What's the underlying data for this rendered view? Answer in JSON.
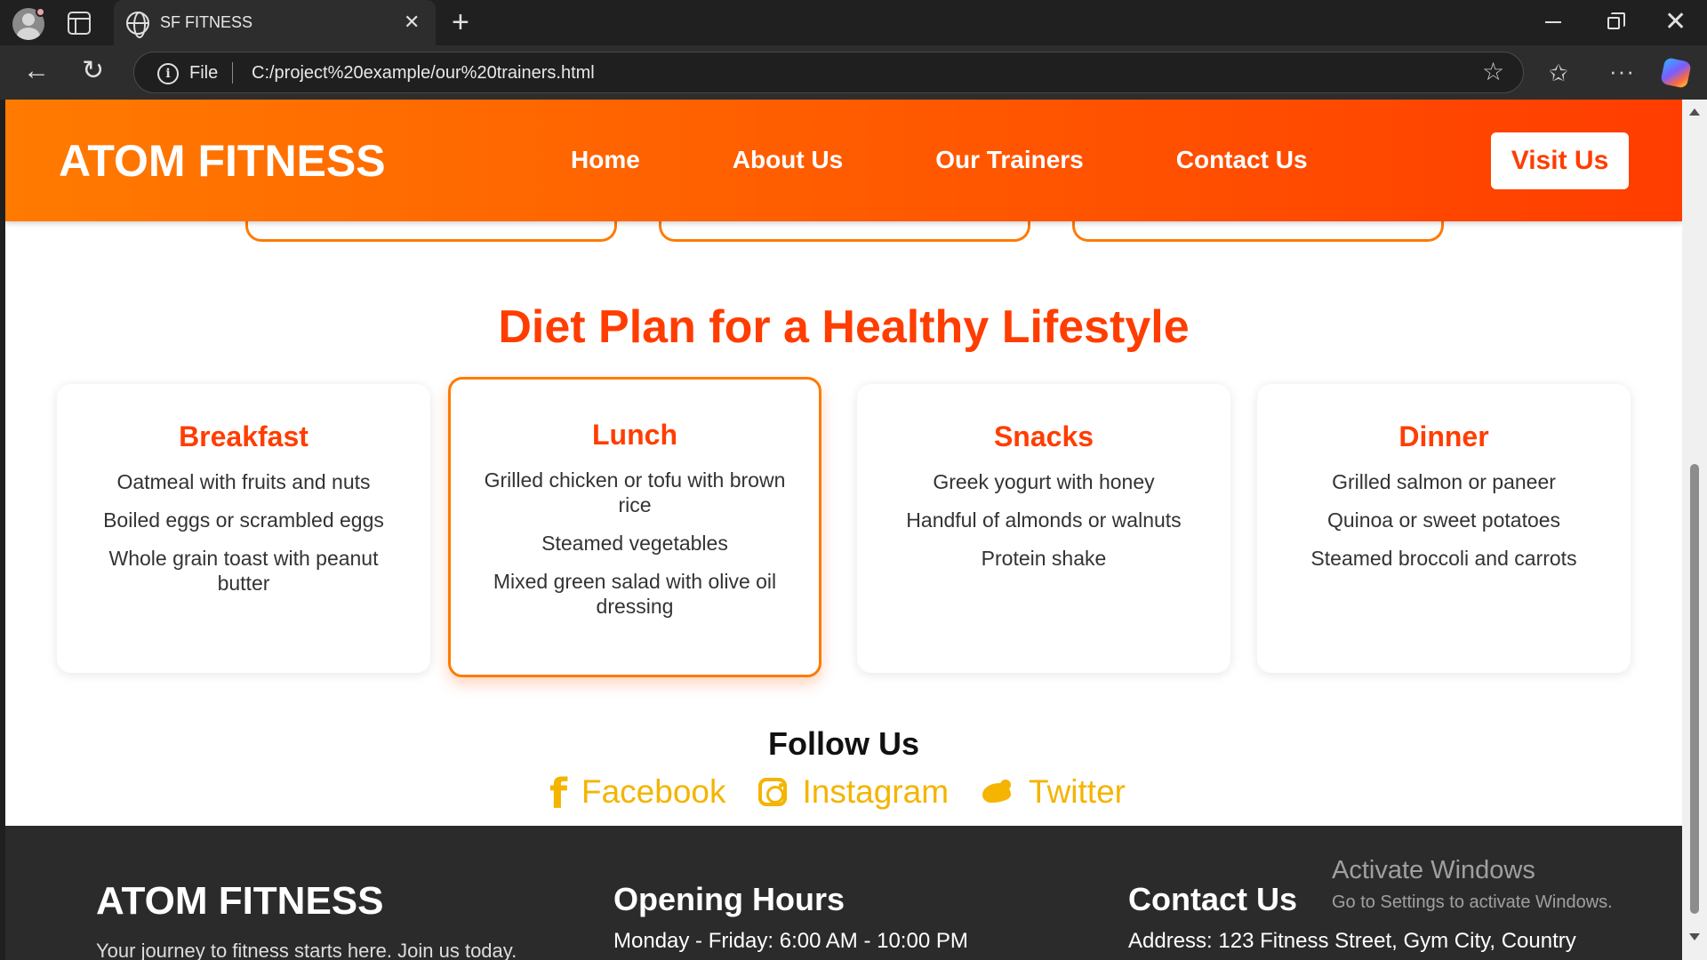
{
  "browser": {
    "tab_title": "SF FITNESS",
    "tab_close": "✕",
    "new_tab": "+",
    "scheme_label": "File",
    "url": "C:/project%20example/our%20trainers.html",
    "info_glyph": "i",
    "back_glyph": "←",
    "reload_glyph": "↻",
    "star_glyph": "☆",
    "favorites_glyph": "✩",
    "more_glyph": "···",
    "close_glyph": "✕"
  },
  "header": {
    "logo": "ATOM FITNESS",
    "nav": [
      "Home",
      "About Us",
      "Our Trainers",
      "Contact Us"
    ],
    "cta": "Visit Us",
    "gradient_start": "#ff7a00",
    "gradient_end": "#ff3d00"
  },
  "diet": {
    "title": "Diet Plan for a Healthy Lifestyle",
    "cards": [
      {
        "title": "Breakfast",
        "items": [
          "Oatmeal with fruits and nuts",
          "Boiled eggs or scrambled eggs",
          "Whole grain toast with peanut butter"
        ]
      },
      {
        "title": "Lunch",
        "items": [
          "Grilled chicken or tofu with brown rice",
          "Steamed vegetables",
          "Mixed green salad with olive oil dressing"
        ]
      },
      {
        "title": "Snacks",
        "items": [
          "Greek yogurt with honey",
          "Handful of almonds or walnuts",
          "Protein shake"
        ]
      },
      {
        "title": "Dinner",
        "items": [
          "Grilled salmon or paneer",
          "Quinoa or sweet potatoes",
          "Steamed broccoli and carrots"
        ]
      }
    ]
  },
  "follow": {
    "title": "Follow Us",
    "links": [
      "Facebook",
      "Instagram",
      "Twitter"
    ],
    "color": "#f4b400"
  },
  "footer": {
    "logo": "ATOM FITNESS",
    "description": "Your journey to fitness starts here. Join us today.",
    "hours_title": "Opening Hours",
    "hours_line": "Monday - Friday: 6:00 AM - 10:00 PM",
    "contact_title": "Contact Us",
    "contact_line": "Address: 123 Fitness Street, Gym City, Country"
  },
  "watermark": {
    "line1": "Activate Windows",
    "line2": "Go to Settings to activate Windows."
  }
}
